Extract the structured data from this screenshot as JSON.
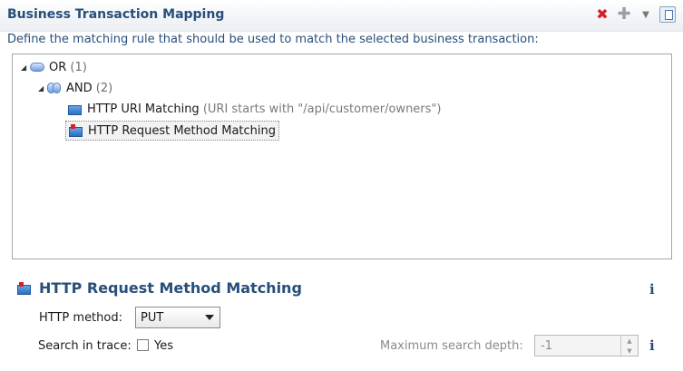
{
  "header": {
    "title": "Business Transaction Mapping",
    "icons": {
      "remove": "close-icon",
      "add": "add-icon",
      "dropdown": "chevron-down-icon",
      "view": "view-menu-icon"
    }
  },
  "description": "Define the matching rule that should be used to match the selected business transaction:",
  "tree": {
    "or_node": {
      "label": "OR",
      "count": "(1)"
    },
    "and_node": {
      "label": "AND",
      "count": "(2)"
    },
    "uri_node": {
      "label": "HTTP URI Matching",
      "detail": "(URI starts with \"/api/customer/owners\")"
    },
    "method_node": {
      "label": "HTTP Request Method Matching"
    }
  },
  "details": {
    "title": "HTTP Request Method Matching",
    "http_method_label": "HTTP method:",
    "http_method_value": "PUT",
    "search_in_trace_label": "Search in trace:",
    "search_in_trace_checkbox": "Yes",
    "search_in_trace_checked": false,
    "max_depth_label": "Maximum search depth:",
    "max_depth_value": "-1",
    "info_symbol": "i"
  },
  "colors": {
    "title": "#274f7a",
    "close": "#d4202a",
    "border": "#a6a6a6"
  }
}
